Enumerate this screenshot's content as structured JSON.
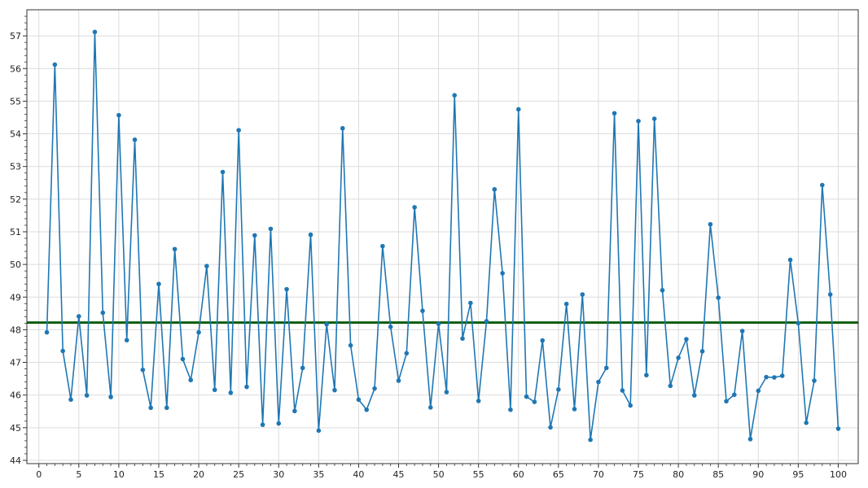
{
  "chart_data": {
    "type": "line",
    "title": "",
    "xlabel": "",
    "ylabel": "",
    "xlim": [
      -1.5,
      102.5
    ],
    "ylim": [
      43.9,
      57.8
    ],
    "grid": true,
    "legend": "none",
    "x_ticks": [
      0,
      5,
      10,
      15,
      20,
      25,
      30,
      35,
      40,
      45,
      50,
      55,
      60,
      65,
      70,
      75,
      80,
      85,
      90,
      95,
      100
    ],
    "y_ticks": [
      44,
      45,
      46,
      47,
      48,
      49,
      50,
      51,
      52,
      53,
      54,
      55,
      56,
      57
    ],
    "series": [
      {
        "color": "#1f77b4",
        "x": [
          1,
          2,
          3,
          4,
          5,
          6,
          7,
          8,
          9,
          10,
          11,
          12,
          13,
          14,
          15,
          16,
          17,
          18,
          19,
          20,
          21,
          22,
          23,
          24,
          25,
          26,
          27,
          28,
          29,
          30,
          31,
          32,
          33,
          34,
          35,
          36,
          37,
          38,
          39,
          40,
          41,
          42,
          43,
          44,
          45,
          46,
          47,
          48,
          49,
          50,
          51,
          52,
          53,
          54,
          55,
          56,
          57,
          58,
          59,
          60,
          61,
          62,
          63,
          64,
          65,
          66,
          67,
          68,
          69,
          70,
          71,
          72,
          73,
          74,
          75,
          76,
          77,
          78,
          79,
          80,
          81,
          82,
          83,
          84,
          85,
          86,
          87,
          88,
          89,
          90,
          91,
          92,
          93,
          94,
          95,
          96,
          97,
          98,
          99,
          100
        ],
        "y": [
          47.92,
          56.12,
          47.35,
          45.86,
          48.41,
          45.99,
          57.12,
          48.52,
          45.94,
          54.57,
          47.68,
          53.82,
          46.77,
          45.61,
          49.4,
          45.61,
          50.47,
          47.1,
          46.46,
          47.92,
          49.95,
          46.16,
          52.83,
          46.07,
          54.11,
          46.25,
          50.89,
          45.09,
          51.09,
          45.13,
          49.24,
          45.51,
          46.83,
          50.91,
          44.91,
          48.17,
          46.15,
          54.17,
          47.52,
          45.86,
          45.55,
          46.2,
          50.56,
          48.09,
          46.44,
          47.28,
          51.75,
          48.58,
          45.62,
          48.18,
          46.09,
          55.18,
          47.73,
          48.82,
          45.82,
          48.26,
          52.3,
          49.73,
          45.55,
          54.75,
          45.95,
          45.79,
          47.67,
          45.01,
          46.17,
          48.79,
          45.57,
          49.08,
          44.63,
          46.4,
          46.83,
          54.63,
          46.14,
          45.68,
          54.39,
          46.61,
          54.46,
          49.21,
          46.28,
          47.14,
          47.71,
          45.99,
          47.34,
          51.23,
          48.98,
          45.81,
          46.01,
          47.96,
          44.65,
          46.13,
          46.55,
          46.54,
          46.59,
          50.14,
          48.2,
          45.15,
          46.44,
          52.43,
          49.08,
          44.97
        ]
      }
    ],
    "reference_lines": [
      {
        "orientation": "horizontal",
        "value": 48.22,
        "color": "#0b5d0b"
      }
    ]
  }
}
